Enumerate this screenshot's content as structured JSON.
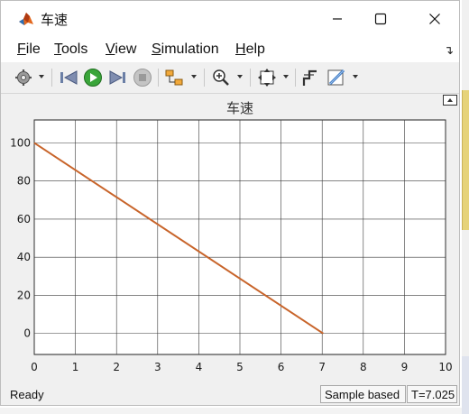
{
  "window": {
    "title": "车速"
  },
  "menu": {
    "items": [
      {
        "first": "F",
        "rest": "ile"
      },
      {
        "first": "T",
        "rest": "ools"
      },
      {
        "first": "V",
        "rest": "iew"
      },
      {
        "first": "S",
        "rest": "imulation"
      },
      {
        "first": "H",
        "rest": "elp"
      }
    ]
  },
  "toolbar": {
    "icons": [
      "gear-icon",
      "step-back-icon",
      "run-icon",
      "step-forward-icon",
      "stop-icon",
      "highlight-block-icon",
      "zoom-in-icon",
      "zoom-to-fit-icon",
      "signal-select-icon",
      "style-icon"
    ]
  },
  "status": {
    "text": "Ready",
    "mode": "Sample based",
    "time": "T=7.025"
  },
  "colors": {
    "line": "#c8642a",
    "grid": "#3a3a3a",
    "background": "#f0f0f0"
  },
  "chart_data": {
    "type": "line",
    "title": "车速",
    "xlabel": "",
    "ylabel": "",
    "xlim": [
      0,
      10
    ],
    "ylim": [
      -11,
      112
    ],
    "xticks": [
      0,
      1,
      2,
      3,
      4,
      5,
      6,
      7,
      8,
      9,
      10
    ],
    "yticks": [
      0,
      20,
      40,
      60,
      80,
      100
    ],
    "grid": true,
    "series": [
      {
        "x": [
          0,
          7.025
        ],
        "y": [
          100,
          0
        ]
      }
    ]
  }
}
